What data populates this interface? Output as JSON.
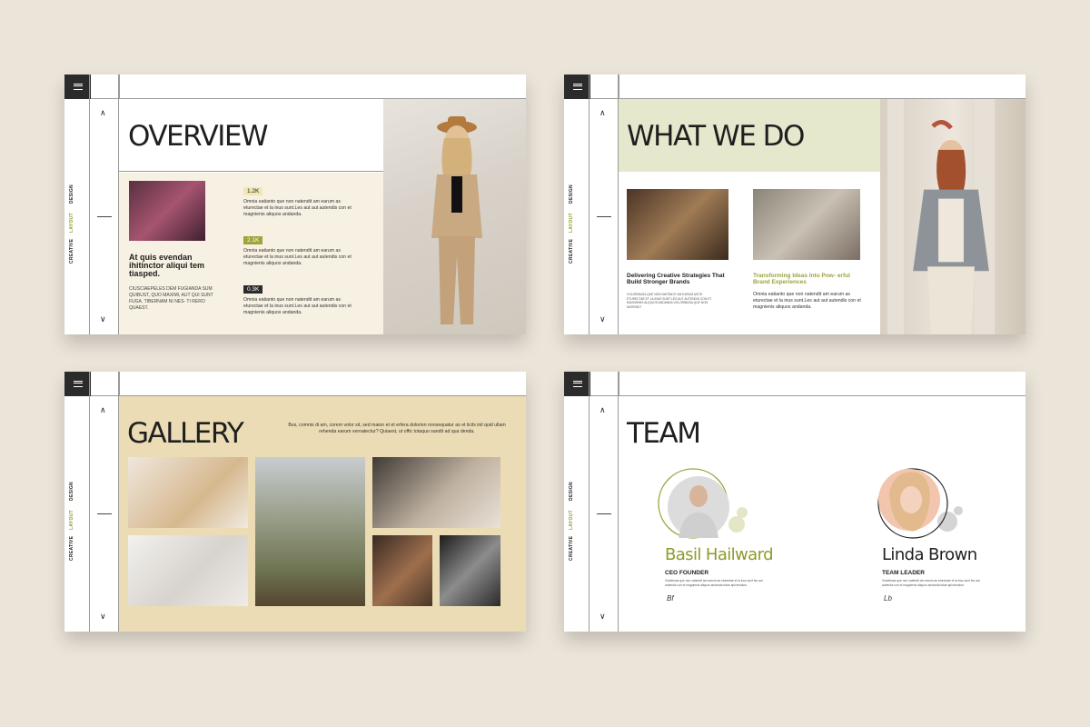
{
  "nav": {
    "design": "DESIGN",
    "layout": "LAYOUT",
    "creative": "CREATIVE"
  },
  "overview": {
    "title": "OVERVIEW",
    "heading": "At quis evendan ihitinctor aliqui tem tiasped.",
    "caps": "CIUSCIAEPELES DEM FUGIANDA SUM QUIBUST, QUO MAXIMI, AUT QUI SUNT FUGA. TIBERNAM NI NES- TI RERO QUAEST.",
    "stats": [
      {
        "value": "1.2K",
        "text": "Omnia eatianto que non natendit am earum as eturectae et la inus sunt.Les aut aut autendis con et magnienis aliquos andanda."
      },
      {
        "value": "2.1K",
        "text": "Omnia eatianto que non natendit am earum as eturectae et la inus sunt.Les aut aut autendis con et magnienis aliquos andanda."
      },
      {
        "value": "0.3K",
        "text": "Omnia eatianto que non natendit am earum as eturectae et la inus sunt.Les aut aut autendis con et magnienis aliquos andanda."
      }
    ]
  },
  "whatwedo": {
    "title": "WHAT WE DO",
    "heading1": "Delivering Creative Strategies That Build Stronger Brands",
    "heading2": "Transforming Ideas Into Pow- erful Brand Experiences",
    "tiny": "VOLORIBUSA QUE NON NATENDIT AM EARUM ASITE ETURECTAE ET LA INUS SUNT LES AUT AUTENDIS CON ET MAGNIENIS ALIQUOS ANDANDA VOLORIBUSA QUE NON NATENDIT",
    "para": "Omnia eatianto que non natendit am earum as eturectae et la inus sunt.Les aut aut autendis con et magnienis aliquos andanda."
  },
  "gallery": {
    "title": "GALLERY",
    "para": "Bus, comnis di am, corem volor sit, sed maion et et erfera dolorion nonsequatur as et licils inil quid ullam rehenda earum vernatectur? Quiaest, ut offic totaquo sandit ad qua denda."
  },
  "team": {
    "title": "TEAM",
    "members": [
      {
        "name": "Basil Hailward",
        "role": "CEO FOUNDER",
        "color": "#8e9a2a",
        "tiny": "Voloribusa que non natendit am earum as eturectae et la inus sunt les aut autendis con et magnienis aliquos andanda tutae apiorendum.",
        "sign": "Bf"
      },
      {
        "name": "Linda Brown",
        "role": "TEAM LEADER",
        "color": "#1f1f1f",
        "tiny": "Voloribusa que non natendit am earum as eturectae et la inus sunt les aut autendis con et magnienis aliquos andanda tutae apiorendum.",
        "sign": "Lb"
      }
    ]
  }
}
